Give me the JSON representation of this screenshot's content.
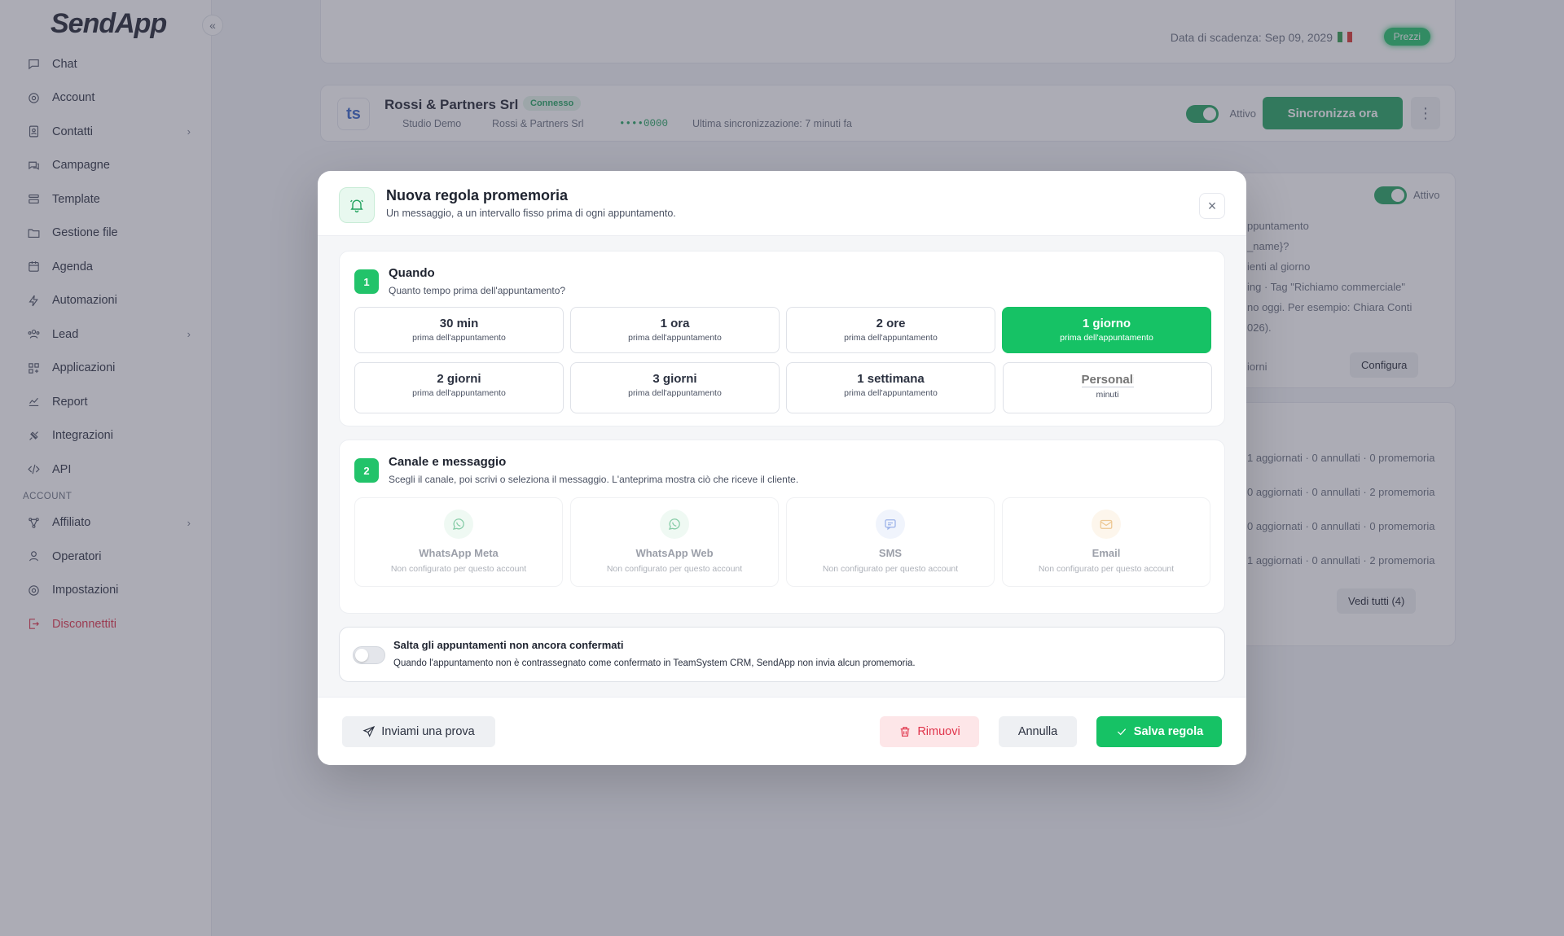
{
  "app": {
    "logo": "SendApp",
    "collapse_glyph": "«"
  },
  "sidebar": {
    "items": [
      {
        "label": "Chat",
        "icon": "chat-icon"
      },
      {
        "label": "Account",
        "icon": "gear-icon"
      },
      {
        "label": "Contatti",
        "icon": "contacts-icon",
        "chevron": "›"
      },
      {
        "label": "Campagne",
        "icon": "campaign-icon"
      },
      {
        "label": "Template",
        "icon": "template-icon"
      },
      {
        "label": "Gestione file",
        "icon": "folder-icon"
      },
      {
        "label": "Agenda",
        "icon": "calendar-icon"
      },
      {
        "label": "Automazioni",
        "icon": "bolt-icon"
      },
      {
        "label": "Lead",
        "icon": "lead-icon",
        "chevron": "›"
      },
      {
        "label": "Applicazioni",
        "icon": "apps-icon"
      },
      {
        "label": "Report",
        "icon": "chart-icon"
      },
      {
        "label": "Integrazioni",
        "icon": "plug-icon"
      },
      {
        "label": "API",
        "icon": "code-icon"
      }
    ],
    "section_label": "ACCOUNT",
    "account_items": [
      {
        "label": "Affiliato",
        "icon": "affiliate-icon",
        "chevron": "›"
      },
      {
        "label": "Operatori",
        "icon": "user-icon"
      },
      {
        "label": "Impostazioni",
        "icon": "gear-icon"
      },
      {
        "label": "Disconnettiti",
        "icon": "logout-icon"
      }
    ]
  },
  "background": {
    "expiry": "Data di scadenza: Sep 09, 2029",
    "prices_label": "Prezzi",
    "integration": {
      "logo": "ts",
      "name": "Rossi & Partners Srl",
      "status": "Connesso",
      "studio": "Studio Demo",
      "owner": "Rossi & Partners Srl",
      "key": "••••0000",
      "last_sync": "Ultima sincronizzazione: 7 minuti fa",
      "toggle_label": "Attivo",
      "sync_button": "Sincronizza ora"
    },
    "rule_card": {
      "toggle_label": "Attivo",
      "lines": [
        "ppuntamento",
        "_name}?",
        "ienti al giorno",
        "ing · Tag \"Richiamo commerciale\"",
        "no oggi. Per esempio: Chiara Conti",
        "026)."
      ],
      "footer_left": "iorni",
      "configure": "Configura"
    },
    "log_card": {
      "rows": [
        "1 aggiornati · 0 annullati · 0 promemoria",
        "0 aggiornati · 0 annullati · 2 promemoria",
        "0 aggiornati · 0 annullati · 0 promemoria",
        "1 aggiornati · 0 annullati · 2 promemoria"
      ],
      "view_all": "Vedi tutti (4)"
    }
  },
  "modal": {
    "title": "Nuova regola promemoria",
    "subtitle": "Un messaggio, a un intervallo fisso prima di ogni appuntamento.",
    "close_glyph": "×",
    "step1": {
      "number": "1",
      "title": "Quando",
      "subtitle": "Quanto tempo prima dell'appuntamento?",
      "options": [
        {
          "label": "30 min",
          "sub": "prima dell'appuntamento"
        },
        {
          "label": "1 ora",
          "sub": "prima dell'appuntamento"
        },
        {
          "label": "2 ore",
          "sub": "prima dell'appuntamento"
        },
        {
          "label": "1 giorno",
          "sub": "prima dell'appuntamento",
          "selected": true
        },
        {
          "label": "2 giorni",
          "sub": "prima dell'appuntamento"
        },
        {
          "label": "3 giorni",
          "sub": "prima dell'appuntamento"
        },
        {
          "label": "1 settimana",
          "sub": "prima dell'appuntamento"
        }
      ],
      "custom": {
        "placeholder": "Personalizzato",
        "unit": "minuti"
      }
    },
    "step2": {
      "number": "2",
      "title": "Canale e messaggio",
      "subtitle": "Scegli il canale, poi scrivi o seleziona il messaggio. L'anteprima mostra ciò che riceve il cliente.",
      "channels": [
        {
          "name": "WhatsApp Meta",
          "status": "Non configurato per questo account",
          "icon": "whatsapp-icon",
          "color": "#22a35f",
          "bg": "#e3f5ea"
        },
        {
          "name": "WhatsApp Web",
          "status": "Non configurato per questo account",
          "icon": "whatsapp-icon",
          "color": "#22a35f",
          "bg": "#e3f5ea"
        },
        {
          "name": "SMS",
          "status": "Non configurato per questo account",
          "icon": "sms-icon",
          "color": "#4a74d8",
          "bg": "#e5ecfb"
        },
        {
          "name": "Email",
          "status": "Non configurato per questo account",
          "icon": "mail-icon",
          "color": "#e09a3a",
          "bg": "#fcf0de"
        }
      ]
    },
    "skip": {
      "title": "Salta gli appuntamenti non ancora confermati",
      "subtitle": "Quando l'appuntamento non è contrassegnato come confermato in TeamSystem CRM, SendApp non invia alcun promemoria."
    },
    "footer": {
      "test": "Inviami una prova",
      "remove": "Rimuovi",
      "cancel": "Annulla",
      "save": "Salva regola"
    }
  },
  "colors": {
    "accent": "#16c265",
    "danger": "#e0344b",
    "overlay": "#46485c"
  }
}
